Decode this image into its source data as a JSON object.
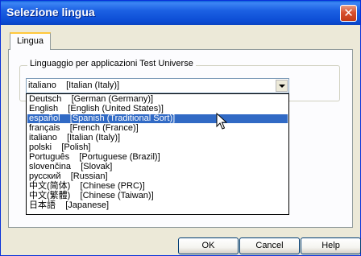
{
  "window": {
    "title": "Selezione lingua"
  },
  "tab": {
    "label": "Lingua"
  },
  "group": {
    "label": "Linguaggio per applicazioni Test Universe"
  },
  "select": {
    "value": "italiano    [Italian (Italy)]"
  },
  "dropdown": {
    "items": [
      "Deutsch    [German (Germany)]",
      "English    [English (United States)]",
      "español    [Spanish (Traditional Sort)]",
      "français    [French (France)]",
      "italiano    [Italian (Italy)]",
      "polski    [Polish]",
      "Português    [Portuguese (Brazil)]",
      "slovenčina    [Slovak]",
      "русский    [Russian]",
      "中文(简体)    [Chinese (PRC)]",
      "中文(繁體)    [Chinese (Taiwan)]",
      "日本語    [Japanese]"
    ],
    "selected_index": 2
  },
  "buttons": {
    "ok": "OK",
    "cancel": "Cancel",
    "help": "Help"
  },
  "colors": {
    "selection": "#316AC5",
    "titlebar": "#0B4CD4",
    "dialog_bg": "#ECE9D8"
  },
  "icons": {
    "close": "close-icon",
    "dropdown_arrow": "chevron-down-icon",
    "cursor": "mouse-pointer-icon"
  }
}
